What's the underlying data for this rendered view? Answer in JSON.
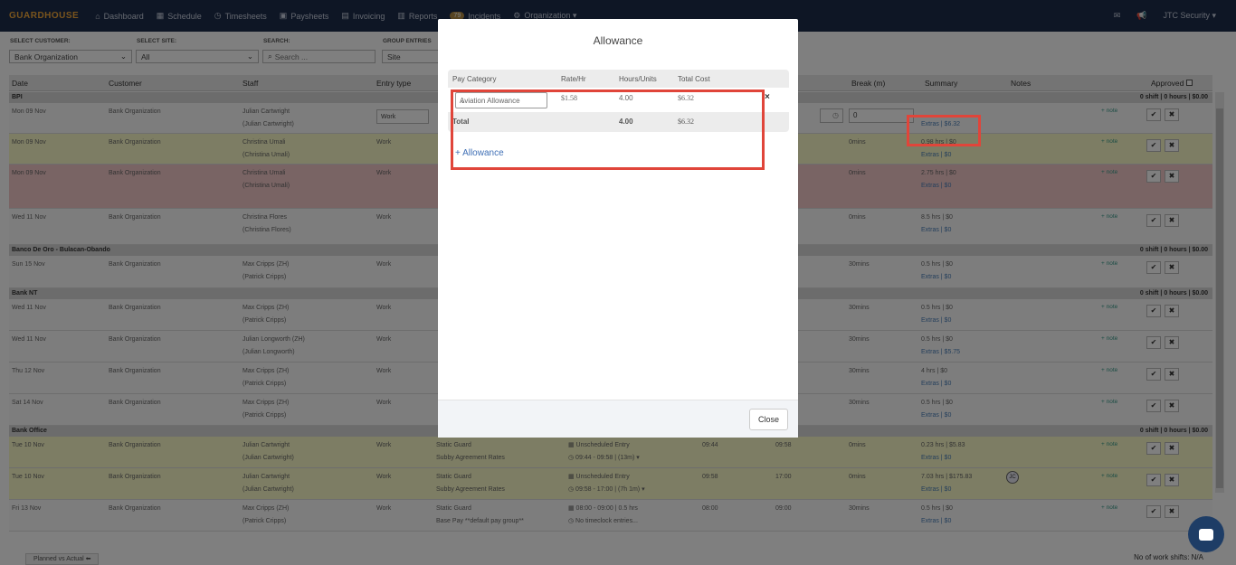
{
  "nav": {
    "logo": "GUARDHOUSE",
    "items": [
      {
        "icon": "dashboard-icon",
        "glyph": "⌂",
        "label": "Dashboard"
      },
      {
        "icon": "calendar-icon",
        "glyph": "▦",
        "label": "Schedule"
      },
      {
        "icon": "clock-icon",
        "glyph": "◷",
        "label": "Timesheets"
      },
      {
        "icon": "money-icon",
        "glyph": "▣",
        "label": "Paysheets"
      },
      {
        "icon": "invoice-icon",
        "glyph": "▤",
        "label": "Invoicing"
      },
      {
        "icon": "reports-icon",
        "glyph": "▥",
        "label": "Reports"
      },
      {
        "icon": "incidents-icon",
        "glyph": "",
        "badge": "79",
        "label": "Incidents"
      },
      {
        "icon": "organization-icon",
        "glyph": "⚙",
        "label": "Organization ▾"
      }
    ],
    "user": "JTC Security ▾"
  },
  "filters": {
    "customer_label": "SELECT CUSTOMER:",
    "customer_value": "Bank Organization",
    "site_label": "SELECT SITE:",
    "site_value": "All",
    "search_label": "SEARCH:",
    "search_placeholder": "Search ...",
    "group_label": "GROUP ENTRIES",
    "group_value": "Site"
  },
  "table": {
    "headers": {
      "date": "Date",
      "customer": "Customer",
      "staff": "Staff",
      "entry": "Entry type",
      "break": "Break (m)",
      "summary": "Summary",
      "notes": "Notes",
      "approved": "Approved"
    },
    "rows": [
      {
        "type": "group",
        "name": "BPI",
        "summary": "0 shift | 0 hours | $0.00"
      },
      {
        "type": "row",
        "style": "",
        "height": 34,
        "date": "Mon 09 Nov",
        "customer": "Bank Organization",
        "staff1": "Julian Cartwright",
        "staff2": "(Julian Cartwright)",
        "entry": "Work",
        "breakv": "",
        "sum1": "",
        "sum2": "Extras | $6.32",
        "editing": true
      },
      {
        "type": "row",
        "style": "yellow",
        "height": 34,
        "date": "Mon 09 Nov",
        "customer": "Bank Organization",
        "staff1": "Christina Umali",
        "staff2": "(Christina Umali)",
        "entry": "Work",
        "breakv": "0mins",
        "sum1": "0.98 hrs | $0",
        "sum2": "Extras | $0"
      },
      {
        "type": "row",
        "style": "red",
        "height": 49,
        "date": "Mon 09 Nov",
        "customer": "Bank Organization",
        "staff1": "Christina Umali",
        "staff2": "(Christina Umali)",
        "entry": "Work",
        "breakv": "0mins",
        "sum1": "2.75 hrs | $0",
        "sum2": "Extras | $0"
      },
      {
        "type": "row",
        "style": "",
        "height": 40,
        "date": "Wed 11 Nov",
        "customer": "Bank Organization",
        "staff1": "Christina Flores",
        "staff2": "(Christina Flores)",
        "entry": "Work",
        "breakv": "0mins",
        "sum1": "8.5 hrs | $0",
        "sum2": "Extras | $0"
      },
      {
        "type": "group",
        "name": "Banco De Oro - Bulacan-Obando",
        "summary": "0 shift | 0 hours | $0.00"
      },
      {
        "type": "row",
        "style": "",
        "height": 36,
        "date": "Sun 15 Nov",
        "customer": "Bank Organization",
        "staff1": "Max Cripps (ZH)",
        "staff2": "(Patrick Cripps)",
        "entry": "Work",
        "breakv": "30mins",
        "sum1": "0.5 hrs | $0",
        "sum2": "Extras | $0"
      },
      {
        "type": "group",
        "name": "Bank NT",
        "summary": "0 shift | 0 hours | $0.00"
      },
      {
        "type": "row",
        "style": "",
        "height": 35,
        "date": "Wed 11 Nov",
        "customer": "Bank Organization",
        "staff1": "Max Cripps (ZH)",
        "staff2": "(Patrick Cripps)",
        "entry": "Work",
        "breakv": "30mins",
        "sum1": "0.5 hrs | $0",
        "sum2": "Extras | $0"
      },
      {
        "type": "row",
        "style": "",
        "height": 35,
        "date": "Wed 11 Nov",
        "customer": "Bank Organization",
        "staff1": "Julian Longworth (ZH)",
        "staff2": "(Julian Longworth)",
        "entry": "Work",
        "breakv": "30mins",
        "sum1": "0.5 hrs | $0",
        "sum2": "Extras | $5.75"
      },
      {
        "type": "row",
        "style": "",
        "height": 35,
        "date": "Thu 12 Nov",
        "customer": "Bank Organization",
        "staff1": "Max Cripps (ZH)",
        "staff2": "(Patrick Cripps)",
        "entry": "Work",
        "breakv": "30mins",
        "sum1": "4 hrs | $0",
        "sum2": "Extras | $0"
      },
      {
        "type": "row",
        "style": "",
        "height": 35,
        "date": "Sat 14 Nov",
        "customer": "Bank Organization",
        "staff1": "Max Cripps (ZH)",
        "staff2": "(Patrick Cripps)",
        "entry": "Work",
        "breakv": "30mins",
        "sum1": "0.5 hrs | $0",
        "sum2": "Extras | $0"
      },
      {
        "type": "group",
        "name": "Bank Office",
        "summary": "0 shift | 0 hours | $0.00"
      },
      {
        "type": "row",
        "style": "yellow",
        "height": 35,
        "date": "Tue 10 Nov",
        "customer": "Bank Organization",
        "staff1": "Julian Cartwright",
        "staff2": "(Julian Cartwright)",
        "entry": "Work",
        "pos1": "Static Guard",
        "pos2": "Subby Agreement Rates",
        "sched1": "▦ Unscheduled Entry",
        "sched2": "◷ 09:44 - 09:58 | (13m) ▾",
        "start": "09:44",
        "end": "09:58",
        "breakv": "0mins",
        "sum1": "0.23 hrs | $5.83",
        "sum2": "Extras | $0"
      },
      {
        "type": "row",
        "style": "yellow",
        "height": 35,
        "date": "Tue 10 Nov",
        "customer": "Bank Organization",
        "staff1": "Julian Cartwright",
        "staff2": "(Julian Cartwright)",
        "entry": "Work",
        "pos1": "Static Guard",
        "pos2": "Subby Agreement Rates",
        "sched1": "▦ Unscheduled Entry",
        "sched2": "◷ 09:58 - 17:00 | (7h 1m) ▾",
        "start": "09:58",
        "end": "17:00",
        "breakv": "0mins",
        "sum1": "7.03 hrs | $175.83",
        "sum2": "Extras | $0",
        "avatar": "JC"
      },
      {
        "type": "row",
        "style": "",
        "height": 35,
        "date": "Fri 13 Nov",
        "customer": "Bank Organization",
        "staff1": "Max Cripps (ZH)",
        "staff2": "(Patrick Cripps)",
        "entry": "Work",
        "pos1": "Static Guard",
        "pos2": "Base Pay **default pay group**",
        "sched1": "▦ 08:00 - 09:00 | 0.5 hrs",
        "sched2": "◷ No timeclock entries...",
        "start": "08:00",
        "end": "09:00",
        "breakv": "30mins",
        "sum1": "0.5 hrs | $0",
        "sum2": "Extras | $0"
      }
    ],
    "note_label": "+ note",
    "approve_glyph": "✔",
    "reject_glyph": "✖",
    "break_input_value": "0"
  },
  "footer": {
    "tab": "Planned vs Actual ⬅",
    "shifts": "No of work shifts: N/A"
  },
  "modal": {
    "title": "Allowance",
    "headers": {
      "category": "Pay Category",
      "rate": "Rate/Hr",
      "hours": "Hours/Units",
      "cost": "Total Cost"
    },
    "row": {
      "category": "Aviation Allowance",
      "rate": "$1.58",
      "hours": "4.00",
      "cost": "$6.32",
      "remove": "×"
    },
    "total": {
      "label": "Total",
      "hours": "4.00",
      "cost": "$6.32"
    },
    "add_label": "+ Allowance",
    "close_label": "Close"
  },
  "colors": {
    "nav_bg": "#1d2c4a",
    "highlight": "#e0453a",
    "link": "#3f6fb5"
  }
}
